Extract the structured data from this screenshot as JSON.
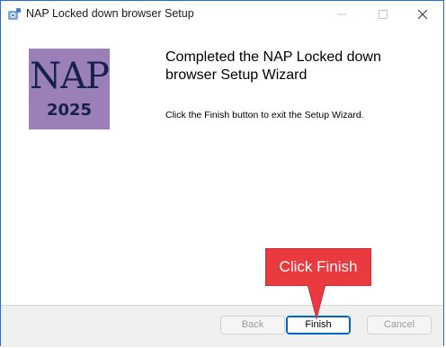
{
  "window": {
    "title": "NAP Locked down browser Setup",
    "controls": [
      "minimize-icon",
      "maximize-icon",
      "close-icon"
    ]
  },
  "logo": {
    "text": "NAP",
    "year": "2025",
    "background": "#9b7fb8",
    "text_color": "#14214f"
  },
  "main": {
    "heading_line1": "Completed the NAP Locked down",
    "heading_line2": "browser Setup Wizard",
    "instruction": "Click the Finish button to exit the Setup Wizard."
  },
  "buttons": {
    "back": "Back",
    "finish": "Finish",
    "cancel": "Cancel"
  },
  "annotation": {
    "label": "Click Finish",
    "color": "#e83a3f"
  },
  "colors": {
    "accent": "#0067c0",
    "footer": "#f0f0f0"
  }
}
